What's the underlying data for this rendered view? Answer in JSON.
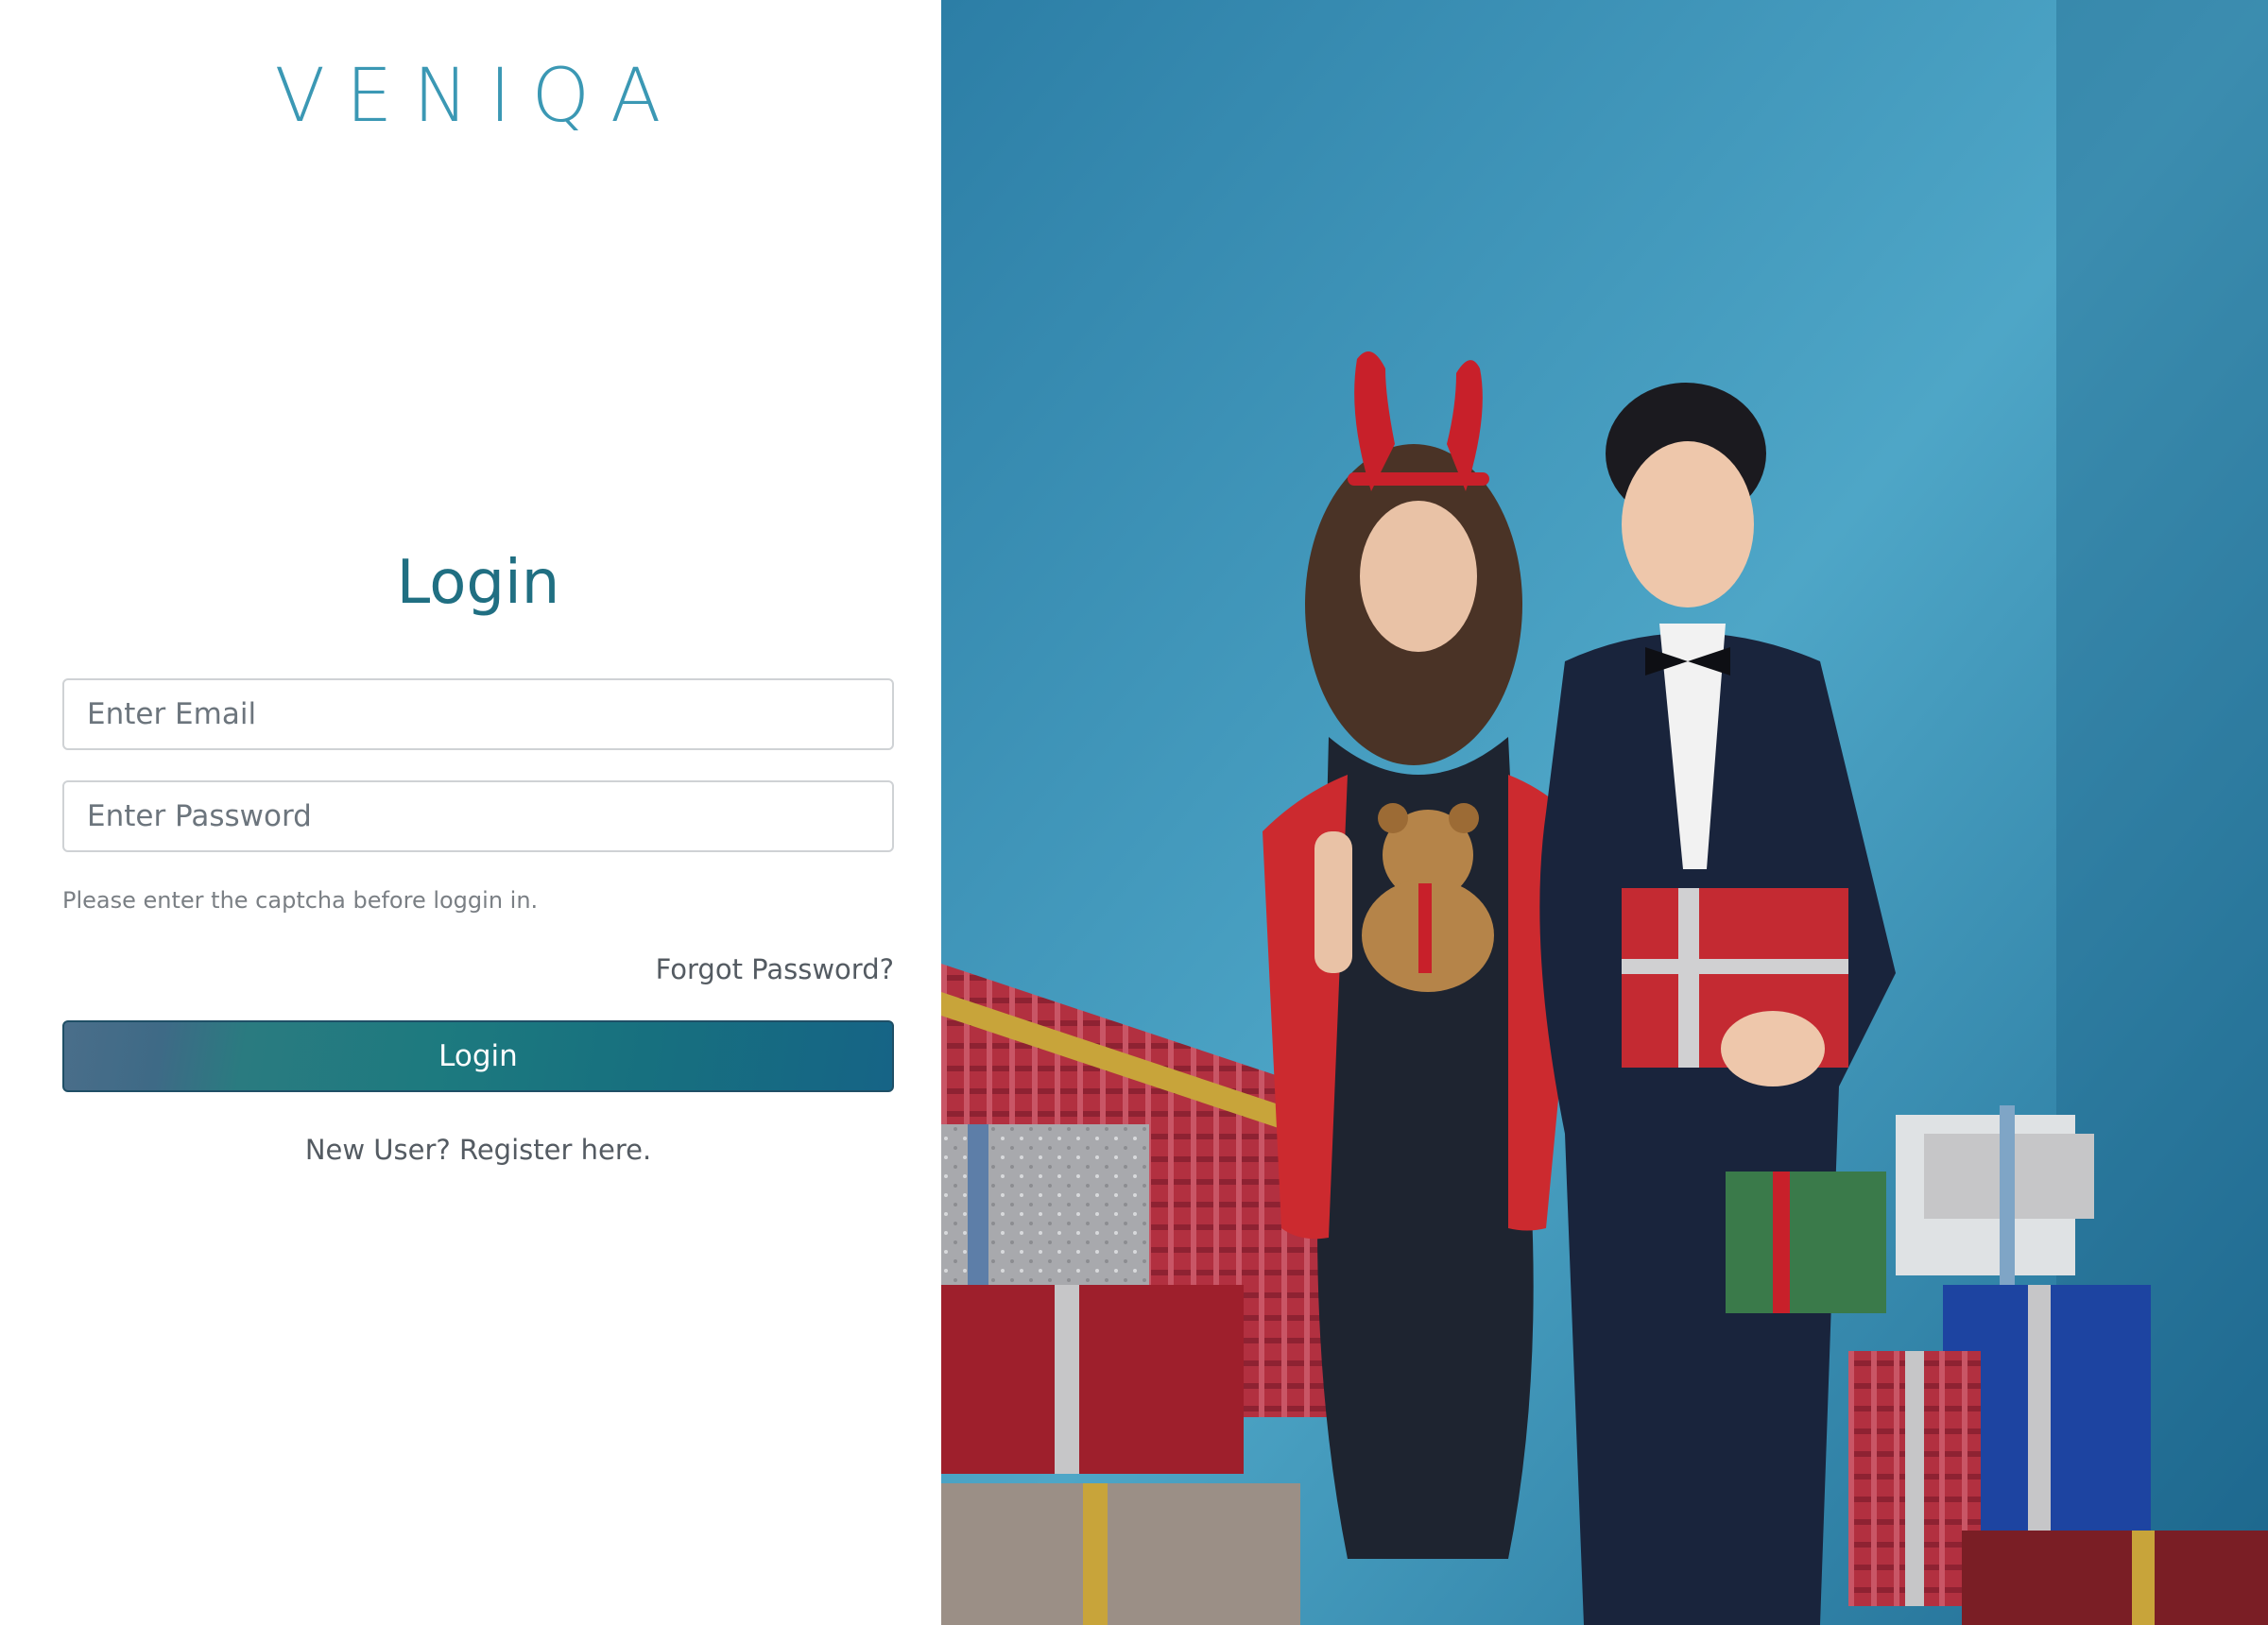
{
  "brand": {
    "logo_text": "VENIQA",
    "color": "#3b98b4"
  },
  "login": {
    "title": "Login",
    "email_placeholder": "Enter Email",
    "password_placeholder": "Enter Password",
    "captcha_notice": "Please enter the captcha before loggin in.",
    "forgot_password": "Forgot Password?",
    "submit_label": "Login",
    "register_link": "New User? Register here."
  },
  "colors": {
    "title": "#206f82",
    "button_start": "#4a6e8a",
    "button_end": "#166486",
    "photo_background": "#3f98bb"
  }
}
